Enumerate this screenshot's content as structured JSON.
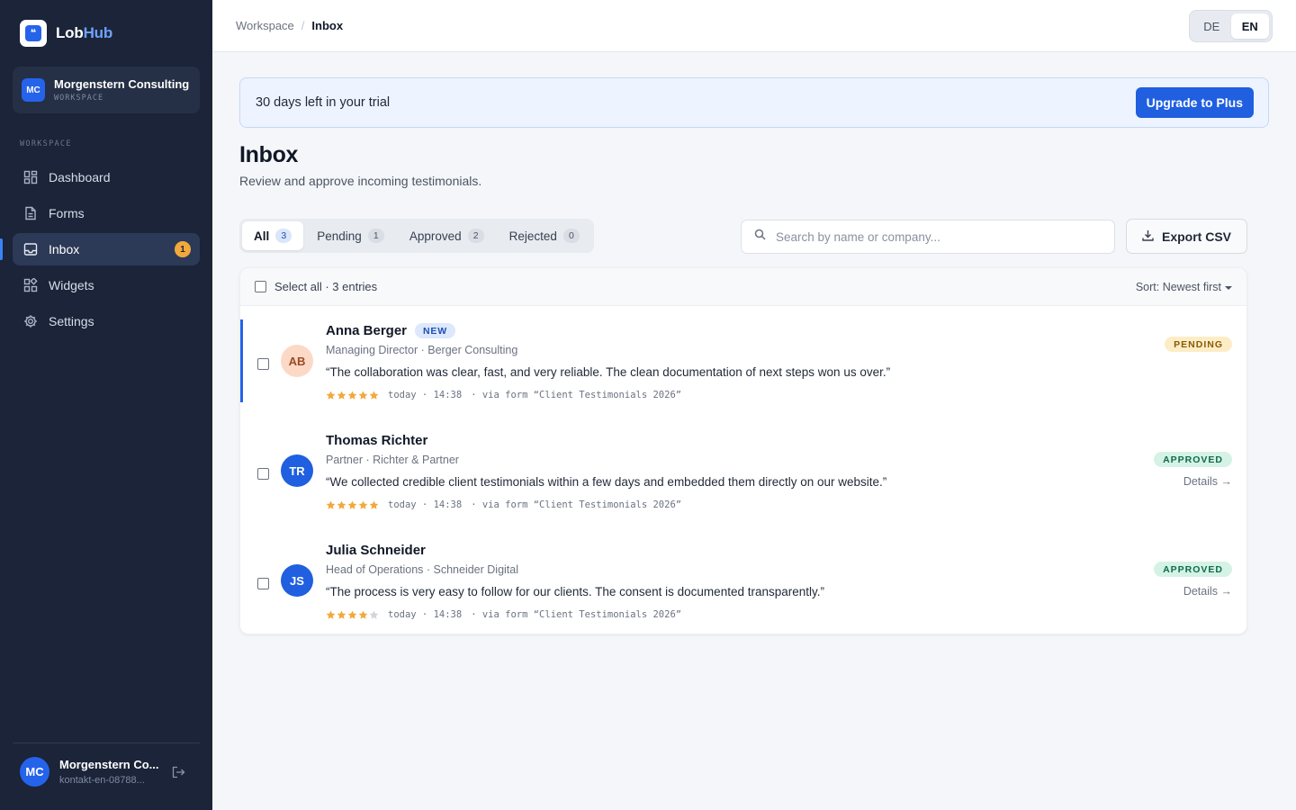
{
  "app": {
    "logo_mark": "❝",
    "name_part1": "Lob",
    "name_part2": "Hub"
  },
  "workspace": {
    "initials": "MC",
    "name": "Morgenstern Consulting",
    "label": "WORKSPACE"
  },
  "sidebar": {
    "section_label": "WORKSPACE",
    "items": [
      {
        "label": "Dashboard",
        "icon": "dashboard-icon"
      },
      {
        "label": "Forms",
        "icon": "document-icon"
      },
      {
        "label": "Inbox",
        "icon": "inbox-icon",
        "badge": "1",
        "active": true
      },
      {
        "label": "Widgets",
        "icon": "widgets-icon"
      },
      {
        "label": "Settings",
        "icon": "gear-icon"
      }
    ]
  },
  "user": {
    "initials": "MC",
    "name": "Morgenstern Co...",
    "email": "kontakt-en-08788..."
  },
  "breadcrumb": {
    "parent": "Workspace",
    "separator": "/",
    "current": "Inbox"
  },
  "language": {
    "options": [
      "DE",
      "EN"
    ],
    "selected": "EN"
  },
  "trial": {
    "text": "30 days left in your trial",
    "button": "Upgrade to Plus"
  },
  "page": {
    "title": "Inbox",
    "subtitle": "Review and approve incoming testimonials."
  },
  "tabs": [
    {
      "label": "All",
      "count": "3",
      "active": true
    },
    {
      "label": "Pending",
      "count": "1"
    },
    {
      "label": "Approved",
      "count": "2"
    },
    {
      "label": "Rejected",
      "count": "0"
    }
  ],
  "search": {
    "placeholder": "Search by name or company...",
    "value": ""
  },
  "export": {
    "label": "Export CSV"
  },
  "list": {
    "select_all": "Select all · 3 entries",
    "sort": "Sort: Newest first",
    "entries": [
      {
        "initials": "AB",
        "name": "Anna Berger",
        "badge": "NEW",
        "role": "Managing Director · Berger Consulting",
        "quote": "“The collaboration was clear, fast, and very reliable. The clean documentation of next steps won us over.”",
        "rating": 5,
        "date": "today · 14:38",
        "source": "· via form “Client Testimonials 2026”",
        "status": "PENDING",
        "details": "",
        "avatar_bg": "#fcd9c6",
        "avatar_color": "#9a4a26"
      },
      {
        "initials": "TR",
        "name": "Thomas Richter",
        "badge": "",
        "role": "Partner · Richter & Partner",
        "quote": "“We collected credible client testimonials within a few days and embedded them directly on our website.”",
        "rating": 5,
        "date": "today · 14:38",
        "source": "· via form “Client Testimonials 2026”",
        "status": "APPROVED",
        "details": "Details →",
        "avatar_bg": "#1f5fe0",
        "avatar_color": "#ffffff"
      },
      {
        "initials": "JS",
        "name": "Julia Schneider",
        "badge": "",
        "role": "Head of Operations · Schneider Digital",
        "quote": "“The process is very easy to follow for our clients. The consent is documented transparently.”",
        "rating": 4,
        "date": "today · 14:38",
        "source": "· via form “Client Testimonials 2026”",
        "status": "APPROVED",
        "details": "Details →",
        "avatar_bg": "#1f5fe0",
        "avatar_color": "#ffffff"
      }
    ]
  },
  "colors": {
    "sidebar_bg": "#1b2438",
    "accent": "#2563eb",
    "star": "#f2a93b",
    "star_empty": "#d1d5db",
    "pending_bg": "#fdedc7",
    "approved_bg": "#d5f2e6"
  }
}
